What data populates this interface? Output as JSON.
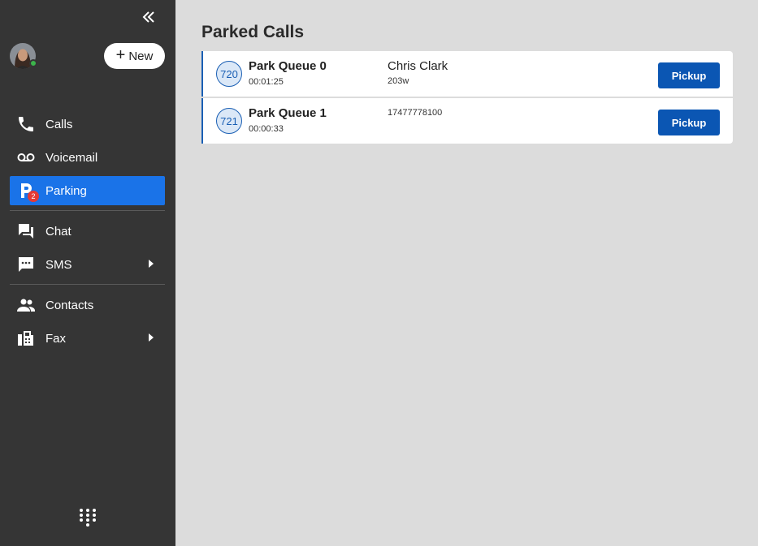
{
  "sidebar": {
    "new_label": "New",
    "items": [
      {
        "label": "Calls",
        "icon": "phone-icon"
      },
      {
        "label": "Voicemail",
        "icon": "voicemail-icon"
      },
      {
        "label": "Parking",
        "icon": "parking-icon",
        "badge": "2",
        "active": true
      },
      {
        "label": "Chat",
        "icon": "chat-icon"
      },
      {
        "label": "SMS",
        "icon": "sms-icon",
        "has_submenu": true
      },
      {
        "label": "Contacts",
        "icon": "contacts-icon"
      },
      {
        "label": "Fax",
        "icon": "fax-icon",
        "has_submenu": true
      }
    ]
  },
  "main": {
    "title": "Parked Calls",
    "calls": [
      {
        "ext": "720",
        "queue": "Park Queue 0",
        "duration": "00:01:25",
        "caller": "Chris Clark",
        "caller_sub": "203w",
        "action": "Pickup"
      },
      {
        "ext": "721",
        "queue": "Park Queue 1",
        "duration": "00:00:33",
        "caller": "17477778100",
        "caller_sub": "",
        "action": "Pickup"
      }
    ]
  },
  "colors": {
    "sidebar_bg": "#353535",
    "active": "#1a73e8",
    "accent": "#0b56b3",
    "presence": "#3cb44b",
    "badge": "#e53935"
  }
}
